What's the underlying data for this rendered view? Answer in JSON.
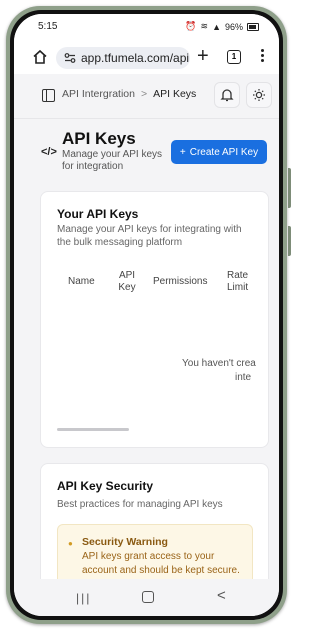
{
  "status_bar": {
    "time": "5:15",
    "battery": "96%"
  },
  "browser": {
    "url": "app.tfumela.com/api",
    "tab_count": "1"
  },
  "breadcrumb": {
    "parent": "API Intergration",
    "separator": ">",
    "current": "API Keys"
  },
  "header": {
    "icon": "</>",
    "title": "API Keys",
    "subtitle": "Manage your API keys for integration",
    "create_button": "Create API Key",
    "create_icon": "+"
  },
  "api_keys_card": {
    "title": "Your API Keys",
    "description": "Manage your API keys for integrating with the bulk messaging platform",
    "columns": [
      "Name",
      "API Key",
      "Permissions",
      "Rate Limit"
    ],
    "empty_line1": "You haven't crea",
    "empty_line2": "inte"
  },
  "security_card": {
    "title": "API Key Security",
    "description": "Best practices for managing API keys",
    "warning_title": "Security Warning",
    "warning_body": "API keys grant access to your account and should be kept secure."
  },
  "colors": {
    "accent": "#1a6fe0",
    "warning_bg": "#fdf7e6",
    "warning_text": "#8a5a12"
  }
}
